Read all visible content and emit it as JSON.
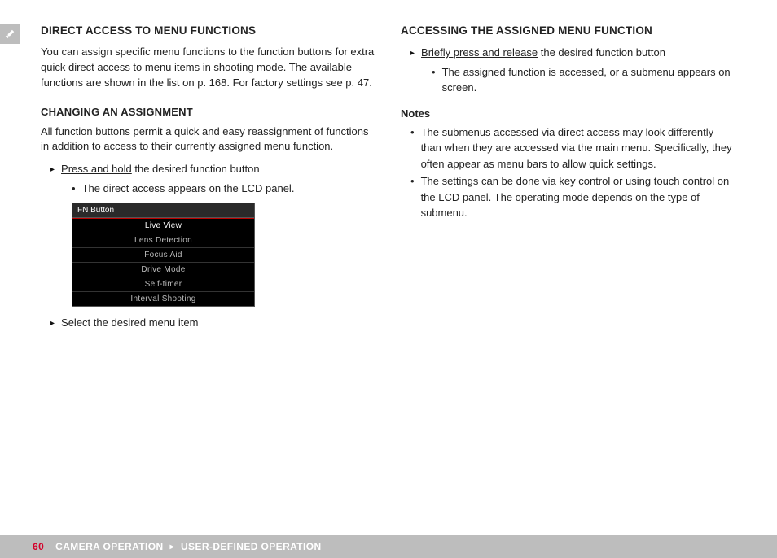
{
  "left": {
    "title": "DIRECT ACCESS TO MENU FUNCTIONS",
    "intro": "You can assign specific menu functions to the function buttons for extra quick direct access to menu items in shooting mode. The available functions are shown in the list on p. 168. For factory settings see p. 47.",
    "sub_title": "CHANGING AN ASSIGNMENT",
    "sub_intro": "All function buttons permit a quick and easy reassignment of functions in addition to access to their currently assigned menu function.",
    "step1_u": "Press and hold",
    "step1_rest": " the desired function button",
    "step1_sub": "The direct access appears on the LCD panel.",
    "menu": {
      "header": "FN Button",
      "items": [
        "Live View",
        "Lens Detection",
        "Focus Aid",
        "Drive Mode",
        "Self-timer",
        "Interval Shooting"
      ]
    },
    "step2": "Select the desired menu item"
  },
  "right": {
    "title": "ACCESSING THE ASSIGNED MENU FUNCTION",
    "step1_u": "Briefly press and release",
    "step1_rest": " the desired function button",
    "step1_sub": "The assigned function is accessed, or a submenu appears on screen.",
    "notes_title": "Notes",
    "note1": "The submenus accessed via direct access may look differently than when they are accessed via the main menu. Specifically, they often appear as menu bars to allow quick settings.",
    "note2": "The settings can be done via key control or using touch control on the LCD panel. The operating mode depends on the type of submenu."
  },
  "footer": {
    "page": "60",
    "section": "CAMERA OPERATION",
    "subsection": "USER-DEFINED OPERATION"
  }
}
